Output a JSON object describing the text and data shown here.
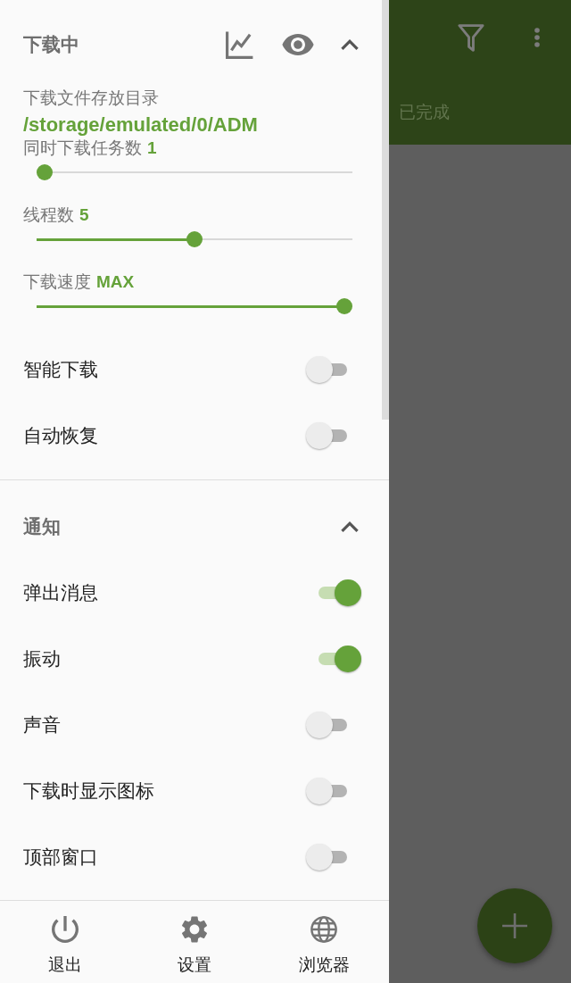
{
  "download_section": {
    "title": "下载中",
    "expanded": true,
    "directory": {
      "label": "下载文件存放目录",
      "path": "/storage/emulated/0/ADM"
    },
    "sliders": [
      {
        "label": "同时下载任务数",
        "reading": "1",
        "level": 0
      },
      {
        "label": "线程数",
        "reading": "5",
        "level": 0.5
      },
      {
        "label": "下载速度",
        "reading": "MAX",
        "level": 1
      }
    ],
    "toggles": [
      {
        "label": "智能下载",
        "on": false
      },
      {
        "label": "自动恢复",
        "on": false
      }
    ]
  },
  "notification_section": {
    "title": "通知",
    "expanded": true,
    "toggles": [
      {
        "label": "弹出消息",
        "on": true
      },
      {
        "label": "振动",
        "on": true
      },
      {
        "label": "声音",
        "on": false
      },
      {
        "label": "下载时显示图标",
        "on": false
      },
      {
        "label": "顶部窗口",
        "on": false
      }
    ]
  },
  "bottom_bar": [
    {
      "kind": "exit",
      "label": "退出"
    },
    {
      "kind": "settings",
      "label": "设置"
    },
    {
      "kind": "browser",
      "label": "浏览器"
    }
  ],
  "background_screen": {
    "tab": "已完成"
  }
}
